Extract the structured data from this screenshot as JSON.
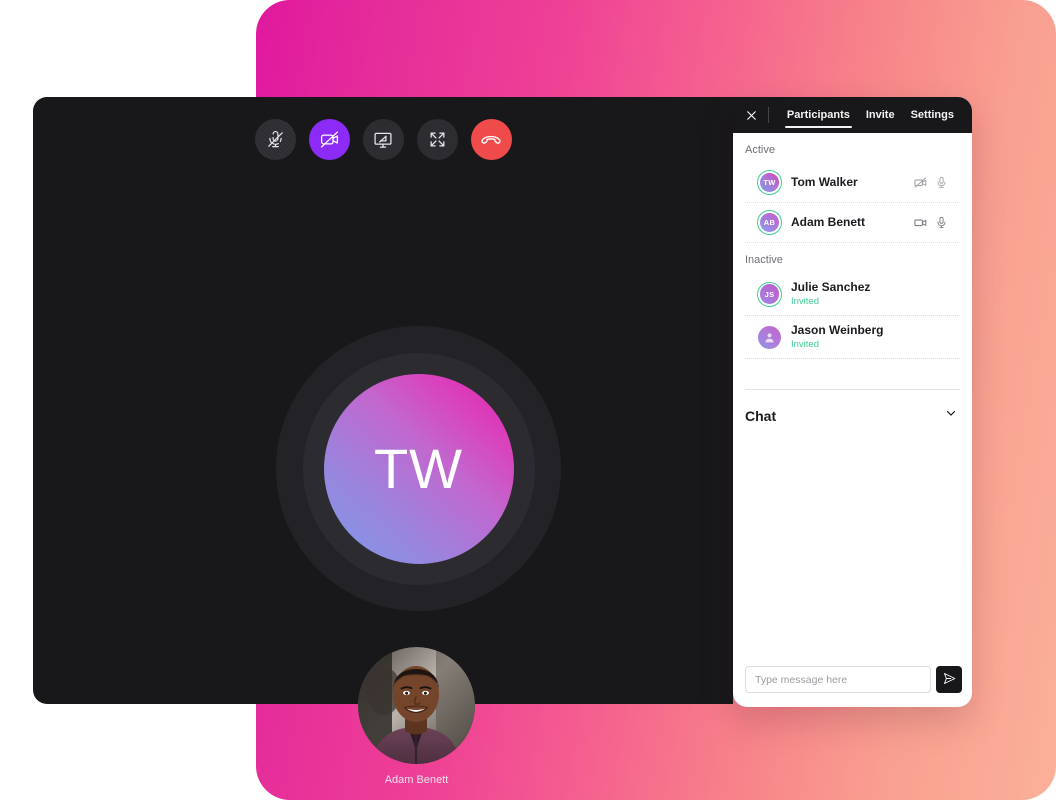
{
  "app": {
    "background_gradient_from": "#e0189f",
    "background_gradient_to": "#fbb09a",
    "accent_purple": "#8b2bf5",
    "danger_red": "#ef4b4b",
    "online_green": "#3fce95",
    "window_bg": "#18181b"
  },
  "toolbar": {
    "buttons": [
      {
        "name": "microphone-off-button",
        "icon": "mic-off-icon",
        "state": "muted",
        "label": "Microphone off"
      },
      {
        "name": "camera-off-button",
        "icon": "video-off-icon",
        "state": "active",
        "label": "Camera off"
      },
      {
        "name": "share-screen-button",
        "icon": "screen-share-icon",
        "state": "default",
        "label": "Share screen"
      },
      {
        "name": "fullscreen-button",
        "icon": "fullscreen-icon",
        "state": "default",
        "label": "Fullscreen"
      },
      {
        "name": "end-call-button",
        "icon": "phone-hangup-icon",
        "state": "danger",
        "label": "End call"
      }
    ]
  },
  "stage": {
    "speaker": {
      "initials": "TW",
      "name": "Tom Walker"
    },
    "self_thumbnail": {
      "name": "Adam Benett",
      "photo_alt": "smiling man in purple shirt"
    }
  },
  "panel": {
    "close_label": "×",
    "tabs": [
      {
        "label": "Participants",
        "active": true
      },
      {
        "label": "Invite",
        "active": false
      },
      {
        "label": "Settings",
        "active": false
      }
    ],
    "sections": [
      {
        "label": "Active",
        "people": [
          {
            "name": "Tom Walker",
            "initials": "TW",
            "status": "",
            "ring": true,
            "avatar_style": "g1",
            "video_icon": "video-off-icon",
            "audio_icon": "mic-icon"
          },
          {
            "name": "Adam Benett",
            "initials": "AB",
            "status": "",
            "ring": true,
            "avatar_style": "g2",
            "video_icon": "video-on-icon",
            "audio_icon": "mic-icon"
          }
        ]
      },
      {
        "label": "Inactive",
        "people": [
          {
            "name": "Julie Sanchez",
            "initials": "JS",
            "status": "Invited",
            "ring": true,
            "avatar_style": "g3",
            "video_icon": "",
            "audio_icon": ""
          },
          {
            "name": "Jason Weinberg",
            "initials": "",
            "status": "Invited",
            "ring": false,
            "avatar_style": "g4",
            "video_icon": "",
            "audio_icon": ""
          }
        ]
      }
    ],
    "chat": {
      "title": "Chat",
      "collapse_icon": "chevron-down-icon",
      "input_placeholder": "Type message here",
      "input_value": "",
      "send_icon": "send-icon"
    }
  }
}
